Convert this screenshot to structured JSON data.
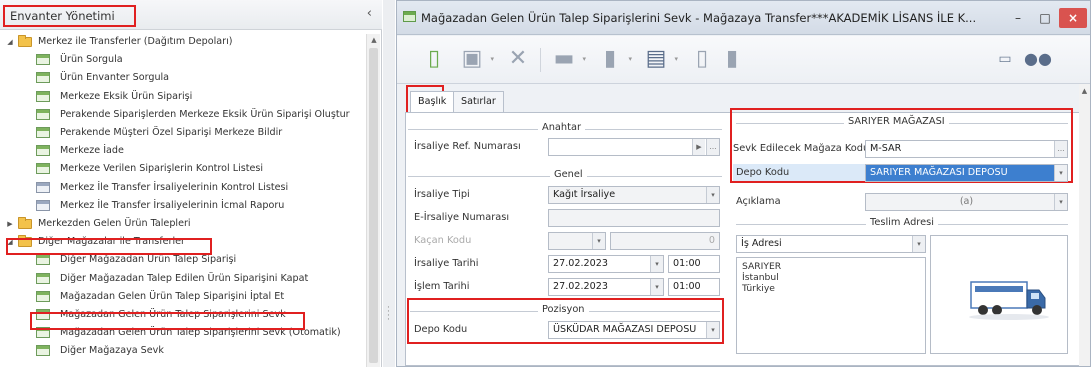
{
  "left_panel": {
    "title": "Envanter Yönetimi",
    "collapse": "‹",
    "items": [
      {
        "label": "Merkez ile Transferler (Dağıtım Depoları)",
        "type": "folder",
        "expanded": true,
        "level": 0
      },
      {
        "label": "Ürün Sorgula",
        "type": "doc",
        "level": 1
      },
      {
        "label": "Ürün Envanter Sorgula",
        "type": "doc",
        "level": 1
      },
      {
        "label": "Merkeze Eksik Ürün Siparişi",
        "type": "doc",
        "level": 1
      },
      {
        "label": "Perakende Siparişlerden Merkeze Eksik Ürün Siparişi Oluştur",
        "type": "doc",
        "level": 1
      },
      {
        "label": "Perakende Müşteri Özel Siparişi Merkeze Bildir",
        "type": "doc",
        "level": 1
      },
      {
        "label": "Merkeze İade",
        "type": "doc",
        "level": 1
      },
      {
        "label": "Merkeze Verilen Siparişlerin Kontrol Listesi",
        "type": "doc",
        "level": 1
      },
      {
        "label": "Merkez İle Transfer İrsaliyelerinin Kontrol Listesi",
        "type": "doc-grey",
        "level": 1
      },
      {
        "label": "Merkez İle Transfer İrsaliyelerinin İcmal Raporu",
        "type": "doc-grey",
        "level": 1
      },
      {
        "label": "Merkezden Gelen Ürün Talepleri",
        "type": "folder",
        "expanded": false,
        "level": 0
      },
      {
        "label": "Diğer Mağazalar ile Transferler",
        "type": "folder",
        "expanded": true,
        "level": 0
      },
      {
        "label": "Diğer Mağazadan Ürün Talep Siparişi",
        "type": "doc",
        "level": 1
      },
      {
        "label": "Diğer Mağazadan Talep Edilen Ürün Siparişini Kapat",
        "type": "doc",
        "level": 1
      },
      {
        "label": "Mağazadan Gelen Ürün Talep Siparişini İptal Et",
        "type": "doc",
        "level": 1
      },
      {
        "label": "Mağazadan Gelen Ürün Talep Siparişlerini Sevk",
        "type": "doc",
        "level": 1
      },
      {
        "label": "Mağazadan Gelen Ürün Talep Siparişlerini Sevk (Otomatik)",
        "type": "doc",
        "level": 1
      },
      {
        "label": "Diğer Mağazaya Sevk",
        "type": "doc",
        "level": 1
      }
    ]
  },
  "window": {
    "title": "Mağazadan Gelen Ürün Talep Siparişlerini Sevk - Mağazaya Transfer***AKADEMİK LİSANS İLE K...",
    "minimize": "–",
    "maximize": "□",
    "close": "×"
  },
  "toolbar": {
    "icons": [
      "new-document-icon",
      "save-icon",
      "delete-icon",
      "print-icon",
      "export-icon",
      "fax-icon",
      "copy-icon",
      "copy-all-icon",
      "window-icon",
      "binoculars-icon"
    ]
  },
  "tabs": [
    "Başlık",
    "Satırlar"
  ],
  "form": {
    "anahtar": {
      "title": "Anahtar",
      "irsaliye_ref_label": "İrsaliye Ref. Numarası",
      "irsaliye_ref_value": ""
    },
    "genel": {
      "title": "Genel",
      "irsaliye_tipi_label": "İrsaliye Tipi",
      "irsaliye_tipi_value": "Kağıt İrsaliye",
      "e_irsaliye_label": "E-İrsaliye Numarası",
      "e_irsaliye_value": "",
      "kacan_kodu_label": "Kaçan Kodu",
      "kacan_kodu_num": "0",
      "irsaliye_tarihi_label": "İrsaliye Tarihi",
      "irsaliye_tarihi_value": "27.02.2023",
      "irsaliye_saat": "01:00",
      "islem_tarihi_label": "İşlem Tarihi",
      "islem_tarihi_value": "27.02.2023",
      "islem_saat": "01:00"
    },
    "pozisyon": {
      "title": "Pozisyon",
      "depo_kodu_label": "Depo Kodu",
      "depo_kodu_value": "ÜSKÜDAR MAĞAZASI DEPOSU"
    },
    "magaza": {
      "title": "SARIYER MAĞAZASI",
      "sevk_label": "Sevk Edilecek Mağaza Kodu",
      "sevk_value": "M-SAR",
      "depo_kodu_label": "Depo Kodu",
      "depo_kodu_value": "SARIYER MAĞAZASI DEPOSU",
      "aciklama_label": "Açıklama",
      "aciklama_value": "(a)"
    },
    "teslim": {
      "title": "Teslim Adresi",
      "adres_tipi": "İş Adresi",
      "lines": [
        "SARIYER",
        "İstanbul",
        "Türkiye"
      ]
    }
  }
}
